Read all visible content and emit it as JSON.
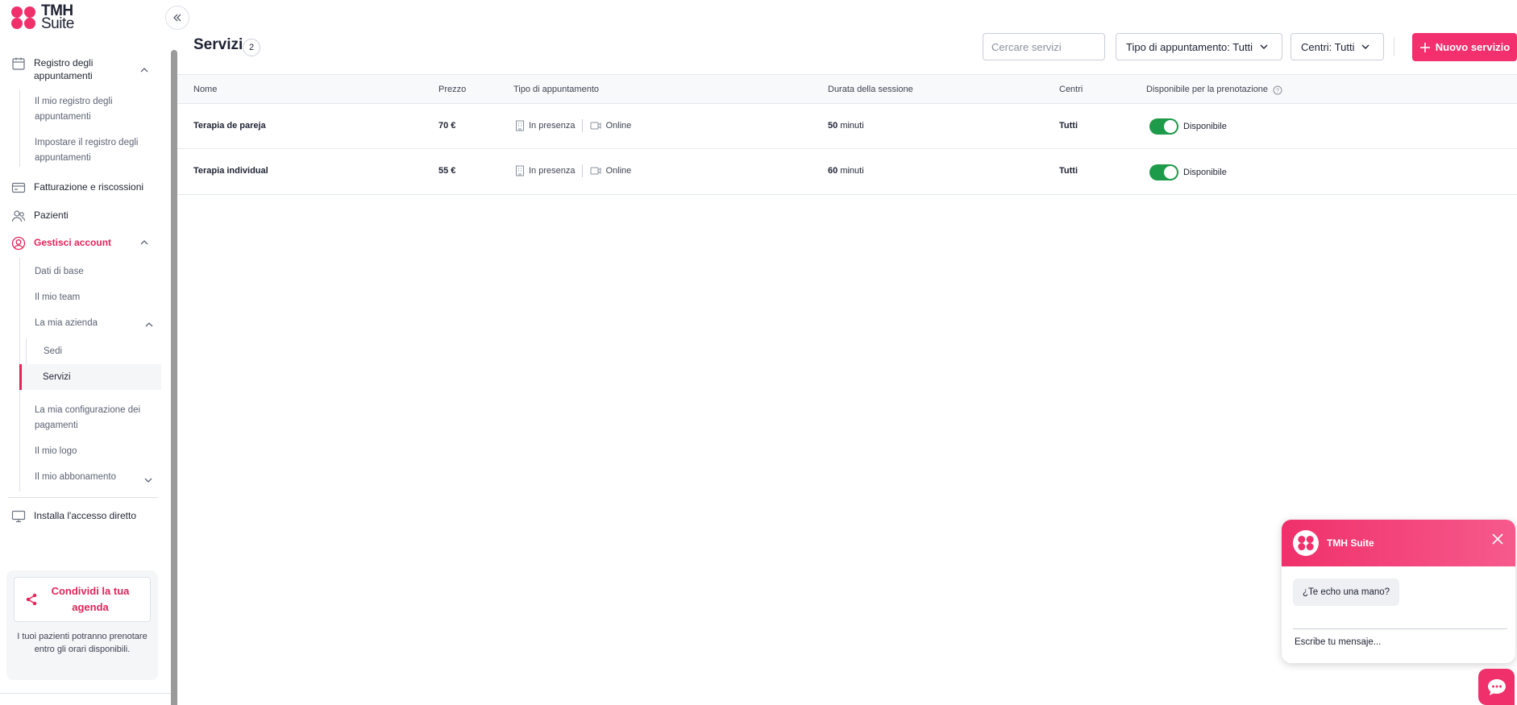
{
  "brand": {
    "name_line1": "TMH",
    "name_line2": "Suite",
    "accent": "#e3245a",
    "success": "#1d9a4a"
  },
  "sidebar": {
    "sections": [
      {
        "label": "Registro degli appuntamenti",
        "icon": "calendar-icon"
      },
      {
        "label": "Fatturazione e riscossioni",
        "icon": "credit-card-icon"
      },
      {
        "label": "Pazienti",
        "icon": "users-icon"
      },
      {
        "label": "Gestisci account",
        "icon": "user-circle-icon"
      },
      {
        "label": "Installa l'accesso diretto",
        "icon": "monitor-icon"
      }
    ],
    "registro_sub": [
      "Il mio registro degli appuntamenti",
      "Impostare il registro degli appuntamenti"
    ],
    "account_sub": {
      "dati": "Dati di base",
      "team": "Il mio team",
      "azienda": "La mia azienda",
      "sedi": "Sedi",
      "servizi": "Servizi",
      "pagamenti": "La mia configurazione dei pagamenti",
      "logo": "Il mio logo",
      "abbonamento": "Il mio abbonamento"
    },
    "share": {
      "button": "Condividi la tua agenda",
      "description": "I tuoi pazienti potranno prenotare entro gli orari disponibili."
    }
  },
  "header": {
    "title": "Servizi",
    "count": "2",
    "search_placeholder": "Cercare servizi",
    "filter_type": "Tipo di appuntamento: Tutti",
    "filter_centers": "Centri: Tutti",
    "new_button": "Nuovo servizio"
  },
  "table": {
    "columns": [
      "Nome",
      "Prezzo",
      "Tipo di appuntamento",
      "Durata della sessione",
      "Centri",
      "Disponibile per la prenotazione"
    ],
    "rows": [
      {
        "name": "Terapia de pareja",
        "price": "70 €",
        "in_person": "In presenza",
        "online": "Online",
        "duration_value": "50",
        "duration_unit": "minuti",
        "centers": "Tutti",
        "available": "Disponibile",
        "available_on": true
      },
      {
        "name": "Terapia individual",
        "price": "55 €",
        "in_person": "In presenza",
        "online": "Online",
        "duration_value": "60",
        "duration_unit": "minuti",
        "centers": "Tutti",
        "available": "Disponibile",
        "available_on": true
      }
    ]
  },
  "chat": {
    "title": "TMH Suite",
    "message": "¿Te echo una mano?",
    "input_placeholder": "Escribe tu mensaje..."
  }
}
